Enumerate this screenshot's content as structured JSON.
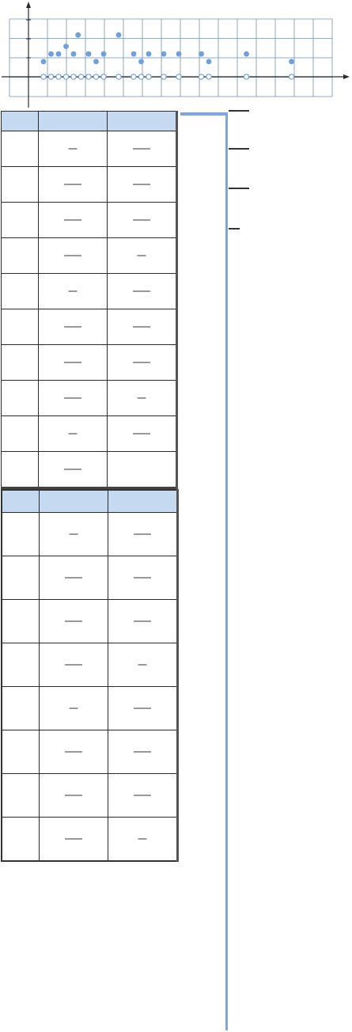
{
  "chart_data": {
    "type": "scatter",
    "title": "",
    "xlabel": "",
    "ylabel": "",
    "grid": true,
    "x_cells": 17,
    "y_cells": 4,
    "series": [
      {
        "marker": "filled",
        "color": "#6fa0dc",
        "x": [
          1,
          1.5,
          2,
          2.5,
          3,
          3.3,
          4,
          4.5,
          5,
          6,
          7,
          7.5,
          8,
          9,
          10,
          11.5,
          12,
          14.5,
          17.5
        ],
        "y": [
          0.8,
          1.2,
          1.2,
          1.6,
          1.2,
          2.2,
          1.2,
          0.8,
          1.2,
          2.2,
          1.2,
          0.8,
          1.2,
          1.2,
          1.2,
          1.2,
          0.8,
          1.2,
          0.8
        ]
      },
      {
        "marker": "hollow",
        "color": "#6fa0dc",
        "x": [
          1,
          1.5,
          2,
          2.5,
          3,
          3.5,
          4,
          4.5,
          5,
          6,
          7,
          7.5,
          8,
          9,
          10,
          11.5,
          12,
          14.5,
          17.5
        ],
        "y": [
          0,
          0,
          0,
          0,
          0,
          0,
          0,
          0,
          0,
          0,
          0,
          0,
          0,
          0,
          0,
          0,
          0,
          0,
          0
        ]
      }
    ]
  },
  "table1": {
    "data_rows": 10,
    "blank_last_cell": true
  },
  "table2": {
    "data_rows": 8
  },
  "side_dashes": 4,
  "colors": {
    "grid": "#6f8fb3",
    "axis": "#2a2a2a",
    "marker": "#6fa0dc",
    "table_header": "#c5d9f1",
    "vertical_rule": "#7ea6d8"
  }
}
